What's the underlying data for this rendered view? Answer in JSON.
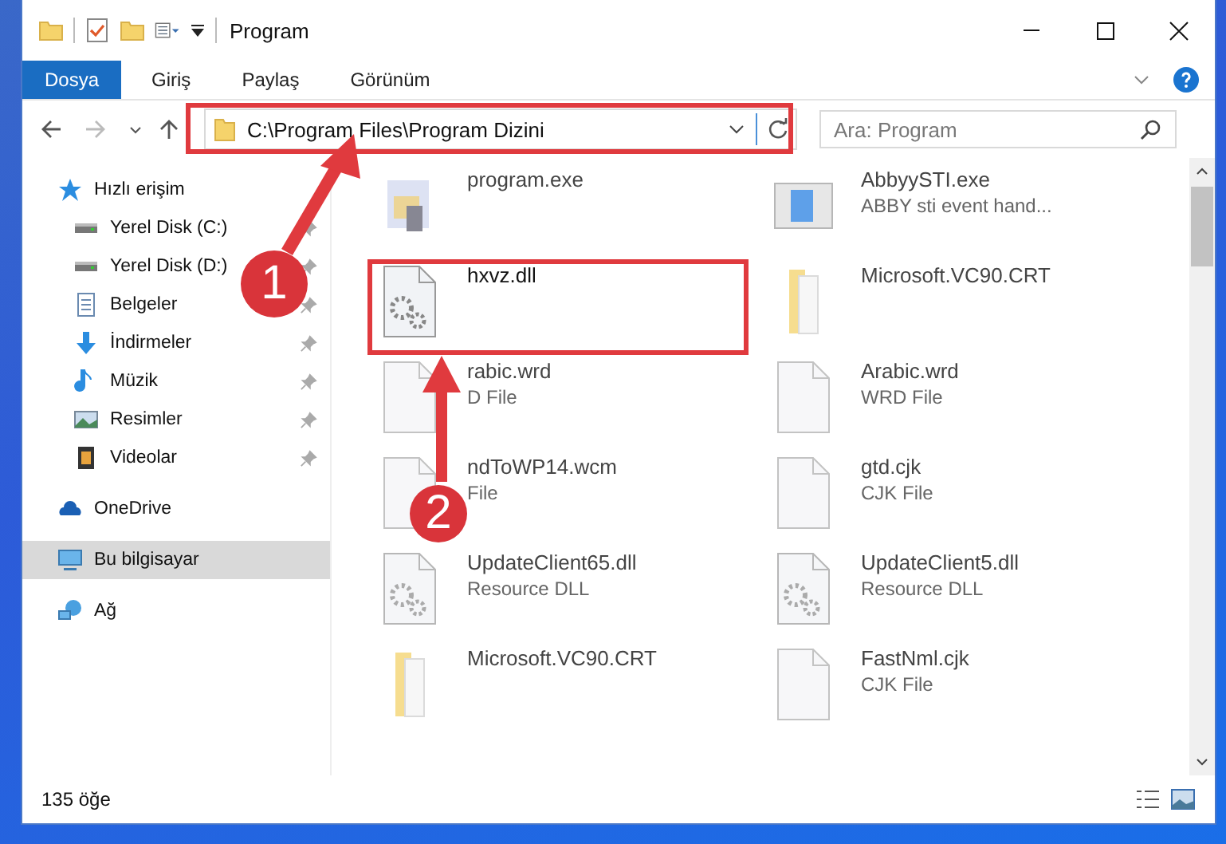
{
  "window": {
    "title": "Program"
  },
  "ribbon": {
    "tabs": [
      {
        "label": "Dosya",
        "selected": true
      },
      {
        "label": "Giriş",
        "selected": false
      },
      {
        "label": "Paylaş",
        "selected": false
      },
      {
        "label": "Görünüm",
        "selected": false
      }
    ]
  },
  "address_bar": {
    "path": "C:\\Program Files\\Program Dizini"
  },
  "search": {
    "placeholder": "Ara: Program"
  },
  "sidebar": {
    "items": [
      {
        "label": "Hızlı erişim",
        "kind": "star",
        "selected": false,
        "children": [
          {
            "label": "Yerel Disk (C:)",
            "kind": "drive",
            "pinned": true,
            "selected": false
          },
          {
            "label": "Yerel Disk (D:)",
            "kind": "drive",
            "pinned": true,
            "selected": false
          },
          {
            "label": "Belgeler",
            "kind": "document",
            "pinned": true,
            "selected": false
          },
          {
            "label": "İndirmeler",
            "kind": "download",
            "pinned": true,
            "selected": false
          },
          {
            "label": "Müzik",
            "kind": "music",
            "pinned": true,
            "selected": false
          },
          {
            "label": "Resimler",
            "kind": "pictures",
            "pinned": true,
            "selected": false
          },
          {
            "label": "Videolar",
            "kind": "video",
            "pinned": true,
            "selected": false
          }
        ]
      },
      {
        "label": "OneDrive",
        "kind": "cloud",
        "selected": false
      },
      {
        "label": "Bu bilgisayar",
        "kind": "computer",
        "selected": true
      },
      {
        "label": "Ağ",
        "kind": "network",
        "selected": false
      }
    ]
  },
  "files": [
    {
      "name": "program.exe",
      "kind": "exe",
      "dimmed": true
    },
    {
      "name": "AbbyySTI.exe",
      "type": "ABBY sti event hand...",
      "kind": "app",
      "dimmed": true
    },
    {
      "name": "hxvz.dll",
      "kind": "dll",
      "dimmed": false
    },
    {
      "name": "Microsoft.VC90.CRT",
      "kind": "folder",
      "dimmed": true
    },
    {
      "name": "rabic.wrd",
      "type": "D File",
      "kind": "file",
      "dimmed": true
    },
    {
      "name": "Arabic.wrd",
      "type": "WRD File",
      "kind": "file",
      "dimmed": true
    },
    {
      "name": "ndToWP14.wcm",
      "type": "File",
      "kind": "file",
      "dimmed": true
    },
    {
      "name": "gtd.cjk",
      "type": "CJK File",
      "kind": "file",
      "dimmed": true
    },
    {
      "name": "UpdateClient65.dll",
      "type": "Resource DLL",
      "kind": "dll",
      "dimmed": true
    },
    {
      "name": "UpdateClient5.dll",
      "type": "Resource DLL",
      "kind": "dll",
      "dimmed": true
    },
    {
      "name": "Microsoft.VC90.CRT",
      "kind": "folder",
      "dimmed": true
    },
    {
      "name": "FastNml.cjk",
      "type": "CJK File",
      "kind": "file",
      "dimmed": true
    }
  ],
  "status_bar": {
    "count": "135 öğe"
  },
  "annotations": [
    {
      "label": "1"
    },
    {
      "label": "2"
    }
  ]
}
